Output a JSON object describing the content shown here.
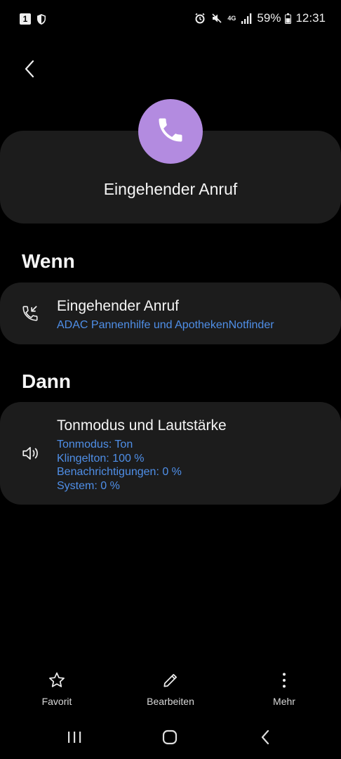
{
  "status_bar": {
    "notification_badge": "1",
    "network": "4G",
    "battery": "59%",
    "time": "12:31"
  },
  "header": {
    "title": "Eingehender Anruf",
    "icon": "phone-icon",
    "avatar_color": "#b38be0"
  },
  "if_section": {
    "heading": "Wenn",
    "card": {
      "icon": "incoming-call-icon",
      "title": "Eingehender Anruf",
      "subtitle": "ADAC Pannenhilfe und ApothekenNotfinder"
    }
  },
  "then_section": {
    "heading": "Dann",
    "card": {
      "icon": "speaker-icon",
      "title": "Tonmodus und Lautstärke",
      "details": [
        "Tonmodus: Ton",
        "Klingelton: 100 %",
        "Benachrichtigungen: 0 %",
        "System: 0 %"
      ]
    }
  },
  "bottom_actions": {
    "favorite": "Favorit",
    "edit": "Bearbeiten",
    "more": "Mehr"
  },
  "colors": {
    "accent_blue": "#4f8fe8",
    "card_bg": "#1c1c1c"
  }
}
